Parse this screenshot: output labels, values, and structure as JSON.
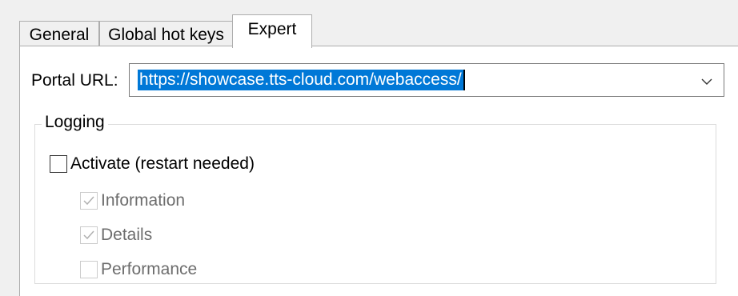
{
  "tabs": [
    {
      "label": "General",
      "active": false
    },
    {
      "label": "Global hot keys",
      "active": false
    },
    {
      "label": "Expert",
      "active": true
    }
  ],
  "portal": {
    "label": "Portal URL:",
    "value": "https://showcase.tts-cloud.com/webaccess/",
    "dropdown_icon": "chevron-down-icon"
  },
  "logging": {
    "title": "Logging",
    "activate": {
      "label": "Activate (restart needed)",
      "checked": false,
      "enabled": true
    },
    "options": [
      {
        "label": "Information",
        "checked": true,
        "enabled": false
      },
      {
        "label": "Details",
        "checked": true,
        "enabled": false
      },
      {
        "label": "Performance",
        "checked": false,
        "enabled": false
      }
    ]
  },
  "colors": {
    "selection": "#0078d7",
    "disabled_text": "#6d6d6d",
    "disabled_border": "#cccccc",
    "check_disabled": "#b0b0b0"
  }
}
